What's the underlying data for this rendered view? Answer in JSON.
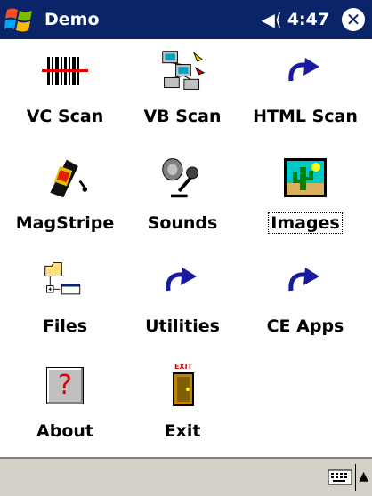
{
  "titlebar": {
    "app_title": "Demo",
    "time": "4:47"
  },
  "items": [
    {
      "label": "VC Scan",
      "icon": "barcode-icon"
    },
    {
      "label": "VB Scan",
      "icon": "network-icon"
    },
    {
      "label": "HTML Scan",
      "icon": "shortcut-arrow-icon"
    },
    {
      "label": "MagStripe",
      "icon": "magstripe-icon"
    },
    {
      "label": "Sounds",
      "icon": "microphone-icon"
    },
    {
      "label": "Images",
      "icon": "cactus-picture-icon",
      "selected": true
    },
    {
      "label": "Files",
      "icon": "folder-tree-icon"
    },
    {
      "label": "Utilities",
      "icon": "shortcut-arrow-icon"
    },
    {
      "label": "CE Apps",
      "icon": "shortcut-arrow-icon"
    },
    {
      "label": "About",
      "icon": "help-icon"
    },
    {
      "label": "Exit",
      "icon": "exit-door-icon"
    }
  ],
  "exit_sign": "EXIT",
  "help_glyph": "?",
  "colors": {
    "titlebar": "#0a246a",
    "taskbar": "#d4d0c8",
    "shortcut_arrow": "#1a1aa0"
  }
}
